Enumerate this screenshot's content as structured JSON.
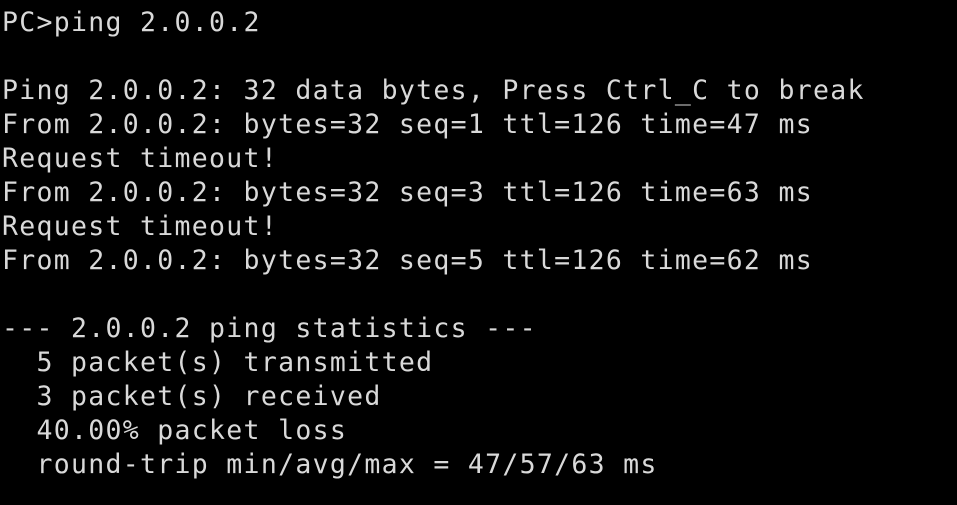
{
  "terminal": {
    "colors": {
      "background": "#000000",
      "foreground": "#d9d9d9"
    },
    "prompt": "PC>",
    "command": "ping 2.0.0.2",
    "target_host": "2.0.0.2",
    "lines": [
      "PC>ping 2.0.0.2",
      "",
      "Ping 2.0.0.2: 32 data bytes, Press Ctrl_C to break",
      "From 2.0.0.2: bytes=32 seq=1 ttl=126 time=47 ms",
      "Request timeout!",
      "From 2.0.0.2: bytes=32 seq=3 ttl=126 time=63 ms",
      "Request timeout!",
      "From 2.0.0.2: bytes=32 seq=5 ttl=126 time=62 ms",
      "",
      "--- 2.0.0.2 ping statistics ---",
      "  5 packet(s) transmitted",
      "  3 packet(s) received",
      "  40.00% packet loss",
      "  round-trip min/avg/max = 47/57/63 ms"
    ],
    "header": {
      "text": "Ping 2.0.0.2: 32 data bytes, Press Ctrl_C to break",
      "data_bytes": "32",
      "break_key": "Ctrl_C"
    },
    "replies": [
      {
        "text": "From 2.0.0.2: bytes=32 seq=1 ttl=126 time=47 ms",
        "bytes": "32",
        "seq": "1",
        "ttl": "126",
        "time_ms": "47"
      },
      {
        "text": "Request timeout!"
      },
      {
        "text": "From 2.0.0.2: bytes=32 seq=3 ttl=126 time=63 ms",
        "bytes": "32",
        "seq": "3",
        "ttl": "126",
        "time_ms": "63"
      },
      {
        "text": "Request timeout!"
      },
      {
        "text": "From 2.0.0.2: bytes=32 seq=5 ttl=126 time=62 ms",
        "bytes": "32",
        "seq": "5",
        "ttl": "126",
        "time_ms": "62"
      }
    ],
    "statistics": {
      "header": "--- 2.0.0.2 ping statistics ---",
      "transmitted": "  5 packet(s) transmitted",
      "received": "  3 packet(s) received",
      "loss": "  40.00% packet loss",
      "round_trip": "  round-trip min/avg/max = 47/57/63 ms",
      "transmitted_count": "5",
      "received_count": "3",
      "loss_percent": "40.00%",
      "rtt_min": "47",
      "rtt_avg": "57",
      "rtt_max": "63",
      "rtt_unit": "ms"
    }
  }
}
